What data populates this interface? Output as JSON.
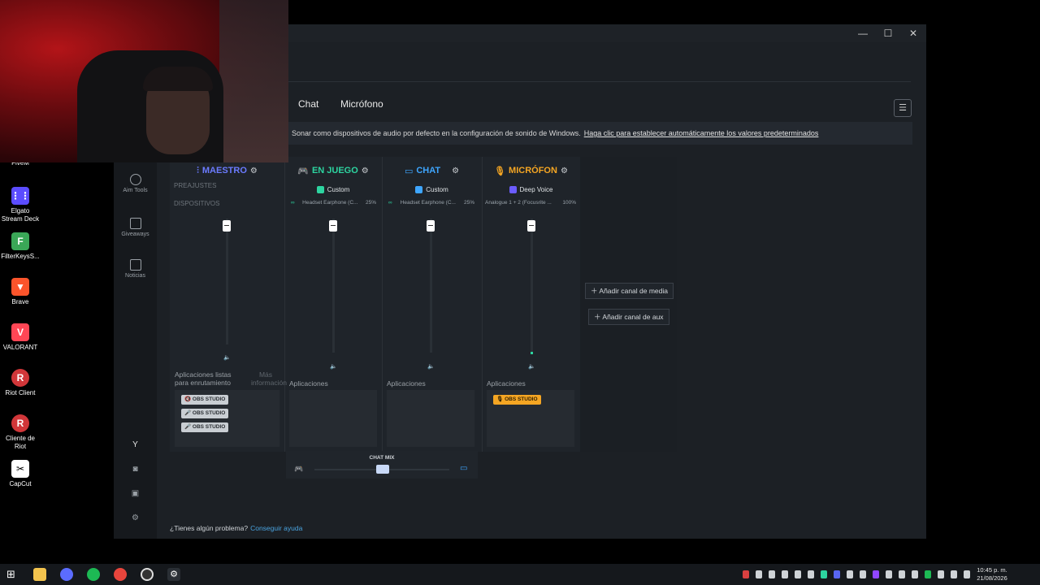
{
  "desktop": {
    "icons": [
      {
        "label": "FiveM",
        "icon": "fivem-icon",
        "color": "#f05a28"
      },
      {
        "label": "Elgato Stream Deck",
        "icon": "stream-deck-icon",
        "color": "#5b4cff"
      },
      {
        "label": "FilterKeysS...",
        "icon": "filterkeys-icon",
        "color": "#3aa757"
      },
      {
        "label": "Brave",
        "icon": "brave-icon",
        "color": "#fb542b"
      },
      {
        "label": "VALORANT",
        "icon": "valorant-icon",
        "color": "#ff4655"
      },
      {
        "label": "Riot Client",
        "icon": "riot-icon",
        "color": "#d13639"
      },
      {
        "label": "Cliente de Riot",
        "icon": "riot-icon",
        "color": "#d13639"
      },
      {
        "label": "CapCut",
        "icon": "capcut-icon",
        "color": "#ffffff"
      }
    ]
  },
  "window": {
    "controls": {
      "minimize": "—",
      "maximize": "☐",
      "close": "✕"
    },
    "tabs": [
      "Chat",
      "Micrófono"
    ],
    "banner": {
      "text": "Sonar como dispositivos de audio por defecto en la configuración de sonido de Windows.",
      "link": "Haga clic para establecer automáticamente los valores predeterminados"
    },
    "rail": [
      {
        "label": "Aim Tools",
        "icon": "aim-tools-icon"
      },
      {
        "label": "Giveaways",
        "icon": "gift-icon"
      },
      {
        "label": "Noticias",
        "icon": "news-icon"
      }
    ],
    "rail_bottom": [
      "Y"
    ],
    "row_labels": {
      "presets": "PREAJUSTES",
      "devices": "DISPOSITIVOS"
    },
    "channels": [
      {
        "name": "MAESTRO",
        "color": "#6b7bff",
        "icon": "sliders-icon",
        "preset": "",
        "device": "",
        "device_pct": "",
        "volume": 1.0,
        "apps_label": "Aplicaciones listas para enrutamiento",
        "apps_more": "Más información",
        "apps": [
          "OBS STUDIO",
          "OBS STUDIO",
          "OBS STUDIO"
        ]
      },
      {
        "name": "EN JUEGO",
        "color": "#2dd4a0",
        "icon": "gamepad-icon",
        "preset": "Custom",
        "device": "Headset Earphone (C...",
        "device_pct": "25%",
        "volume": 1.0,
        "apps_label": "Aplicaciones",
        "apps": []
      },
      {
        "name": "CHAT",
        "color": "#3ea6ff",
        "icon": "chat-icon",
        "preset": "Custom",
        "device": "Headset Earphone (C...",
        "device_pct": "25%",
        "volume": 1.0,
        "apps_label": "Aplicaciones",
        "apps": []
      },
      {
        "name": "MICRÓFON",
        "color": "#f5a623",
        "icon": "mic-icon",
        "preset": "Deep Voice",
        "device": "Analogue 1 + 2 (Focusrite ...",
        "device_pct": "100%",
        "volume": 1.0,
        "apps_label": "Aplicaciones",
        "apps": [
          "OBS STUDIO"
        ]
      }
    ],
    "add_media": "Añadir canal de media",
    "add_aux": "Añadir canal de aux",
    "chatmix": {
      "label": "CHAT MIX",
      "value": 0.5
    },
    "help": {
      "text": "¿Tienes algún problema?",
      "link": "Conseguir ayuda"
    }
  },
  "taskbar": {
    "clock_time": "10:45 p. m.",
    "clock_date": "21/08/2026"
  }
}
